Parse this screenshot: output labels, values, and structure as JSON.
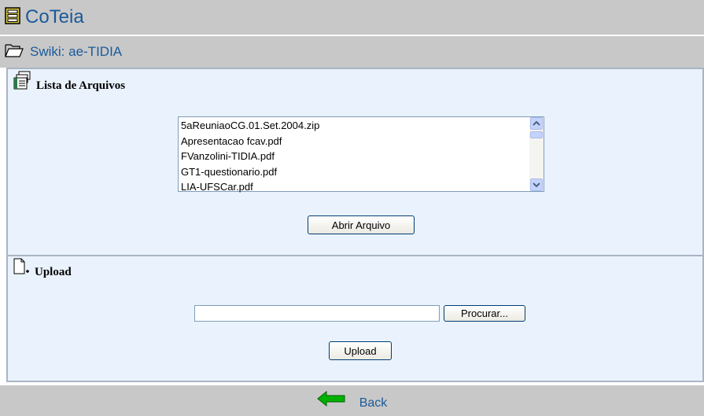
{
  "header": {
    "app_title": "CoTeia",
    "swiki_title": "Swiki: ae-TIDIA"
  },
  "files_section": {
    "heading": "Lista de Arquivos",
    "files": [
      "5aReuniaoCG.01.Set.2004.zip",
      "Apresentacao fcav.pdf",
      "FVanzolini-TIDIA.pdf",
      "GT1-questionario.pdf",
      "LIA-UFSCar.pdf"
    ],
    "open_button": "Abrir Arquivo"
  },
  "upload_section": {
    "heading": "Upload",
    "file_value": "",
    "browse_button": "Procurar...",
    "upload_button": "Upload"
  },
  "footer": {
    "back_label": "Back"
  },
  "colors": {
    "bar": "#c8c8c8",
    "panel": "#eaf3fd",
    "link": "#1a5a9a",
    "back_arrow": "#00b000"
  }
}
